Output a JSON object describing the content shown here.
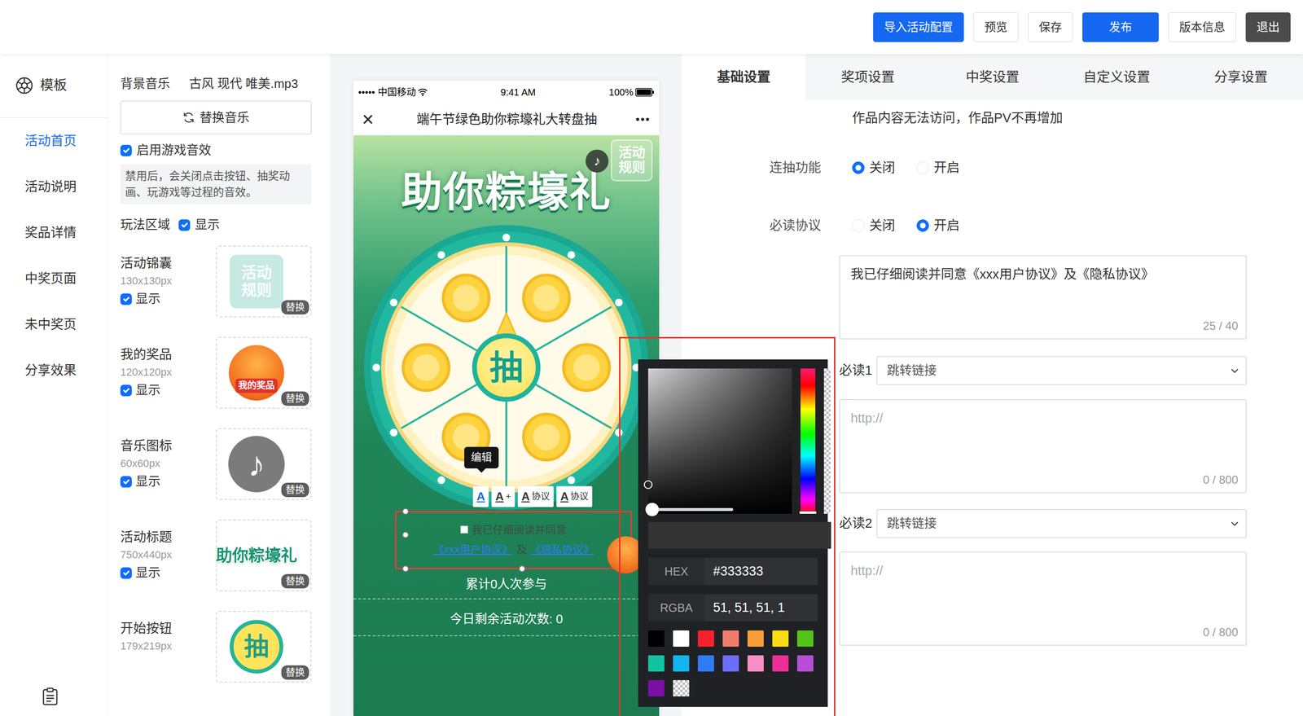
{
  "toolbar": {
    "buttons": [
      {
        "label": "导入活动配置",
        "kind": "primary"
      },
      {
        "label": "预览",
        "kind": "default"
      },
      {
        "label": "保存",
        "kind": "default"
      },
      {
        "label": "发布",
        "kind": "primary"
      },
      {
        "label": "版本信息",
        "kind": "default"
      },
      {
        "label": "退出",
        "kind": "dark"
      }
    ]
  },
  "nav": {
    "template": "模板",
    "items": [
      {
        "label": "活动首页",
        "selected": true
      },
      {
        "label": "活动说明",
        "selected": false
      },
      {
        "label": "奖品详情",
        "selected": false
      },
      {
        "label": "中奖页面",
        "selected": false
      },
      {
        "label": "未中奖页",
        "selected": false
      },
      {
        "label": "分享效果",
        "selected": false
      }
    ]
  },
  "settings": {
    "music_label": "背景音乐",
    "music_file": "古风 现代 唯美.mp3",
    "replace_music": "替换音乐",
    "sound": {
      "label": "启用游戏音效",
      "checked": true
    },
    "sound_hint": "禁用后，会关闭点击按钮、抽奖动画、玩游戏等过程的音效。",
    "play_area": {
      "label": "玩法区域",
      "show": "显示",
      "checked": true
    },
    "assets": [
      {
        "name": "活动锦囊",
        "size": "130x130px",
        "show": "显示",
        "checked": true,
        "replace": "替换",
        "kind": "rules",
        "thumb_text": "活动规则"
      },
      {
        "name": "我的奖品",
        "size": "120x120px",
        "show": "显示",
        "checked": true,
        "replace": "替换",
        "kind": "gift",
        "thumb_text": "我的奖品"
      },
      {
        "name": "音乐图标",
        "size": "60x60px",
        "show": "显示",
        "checked": true,
        "replace": "替换",
        "kind": "music",
        "thumb_text": "♪"
      },
      {
        "name": "活动标题",
        "size": "750x440px",
        "show": "显示",
        "checked": true,
        "replace": "替换",
        "kind": "title",
        "thumb_text": "助你粽壕礼"
      },
      {
        "name": "开始按钮",
        "size": "179x219px",
        "replace": "替换",
        "kind": "start",
        "thumb_text": "抽"
      }
    ]
  },
  "phone": {
    "carrier": "••••• 中国移动",
    "time": "9:41 AM",
    "battery": "100%",
    "close": "×",
    "title": "端午节绿色助你粽壕礼大转盘抽",
    "more": "•••",
    "rules_badge": "活动规则",
    "music_icon": "♪",
    "banner_title": "助你粽壕礼",
    "start": "抽",
    "tooltip": "编辑",
    "text_tools": [
      {
        "glyph": "A",
        "selected": true
      },
      {
        "glyph": "A",
        "suffix": "+",
        "selected": false
      },
      {
        "glyph": "A",
        "suffix": "协议",
        "selected": false
      },
      {
        "glyph": "A",
        "suffix": "协议",
        "selected": false
      }
    ],
    "agree": {
      "checked": false,
      "text": "我已仔细阅读并同意",
      "link1": "《xxx用户协议》",
      "joiner": "及",
      "link2": "《隐私协议》"
    },
    "stats": [
      "累计0人次参与",
      "今日剩余活动次数: 0"
    ]
  },
  "picker": {
    "hex_label": "HEX",
    "hex": "#333333",
    "rgba_label": "RGBA",
    "rgba": "51, 51, 51, 1",
    "cursor_x": 0,
    "cursor_y": 0.8,
    "hue_level": 1,
    "slider_level": 0,
    "swatches": [
      {
        "color": "#000000",
        "kind": "solid"
      },
      {
        "color": "#ffffff",
        "kind": "solid"
      },
      {
        "color": "#f5222d",
        "kind": "solid"
      },
      {
        "color": "#f07c6c",
        "kind": "solid"
      },
      {
        "color": "#fa9d3b",
        "kind": "solid"
      },
      {
        "color": "#fadb14",
        "kind": "solid"
      },
      {
        "color": "#52c41a",
        "kind": "solid"
      },
      {
        "color": "#13c2a3",
        "kind": "solid"
      },
      {
        "color": "#13b5f0",
        "kind": "solid"
      },
      {
        "color": "#2f7cf6",
        "kind": "solid"
      },
      {
        "color": "#6b6ef7",
        "kind": "solid"
      },
      {
        "color": "#f78fc3",
        "kind": "solid"
      },
      {
        "color": "#eb2f96",
        "kind": "solid"
      },
      {
        "color": "#b44fd6",
        "kind": "solid"
      },
      {
        "color": "#7b0fa6",
        "kind": "solid"
      },
      {
        "color": "#ffffff",
        "kind": "transparent"
      }
    ]
  },
  "panel": {
    "tabs": [
      {
        "label": "基础设置",
        "selected": true
      },
      {
        "label": "奖项设置",
        "selected": false
      },
      {
        "label": "中奖设置",
        "selected": false
      },
      {
        "label": "自定义设置",
        "selected": false
      },
      {
        "label": "分享设置",
        "selected": false
      }
    ],
    "notice": "作品内容无法访问，作品PV不再增加",
    "fields": [
      {
        "label": "连抽功能",
        "options": [
          {
            "label": "关闭",
            "selected": true
          },
          {
            "label": "开启",
            "selected": false
          }
        ]
      },
      {
        "label": "必读协议",
        "options": [
          {
            "label": "关闭",
            "selected": false
          },
          {
            "label": "开启",
            "selected": true
          }
        ]
      }
    ],
    "agreement": {
      "value": "我已仔细阅读并同意《xxx用户协议》及《隐私协议》",
      "count": "25 / 40"
    },
    "links": [
      {
        "label": "必读1",
        "select": "跳转链接",
        "placeholder": "http://",
        "count": "0 / 800"
      },
      {
        "label": "必读2",
        "select": "跳转链接",
        "placeholder": "http://",
        "count": "0 / 800"
      }
    ]
  }
}
